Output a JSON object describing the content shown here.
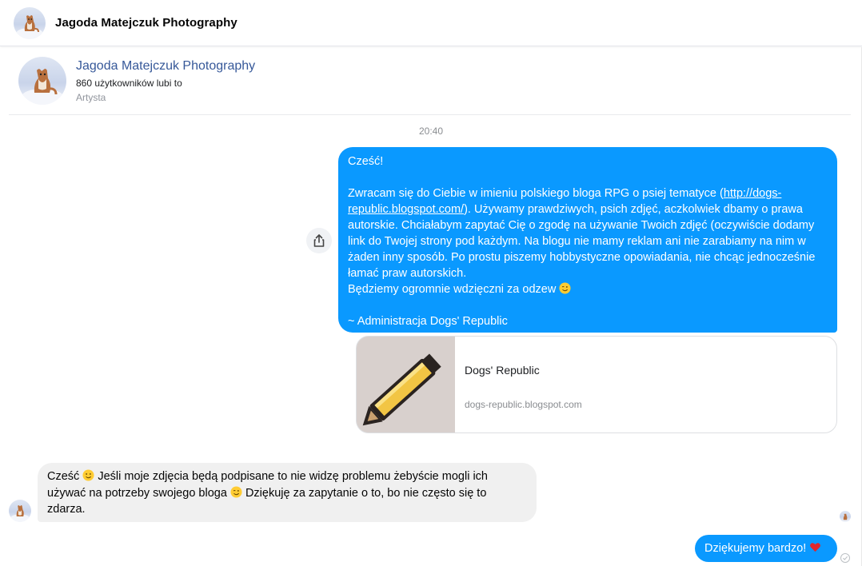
{
  "header": {
    "title": "Jagoda Matejczuk Photography",
    "avatar_icon": "dog-avatar"
  },
  "profile": {
    "name": "Jagoda Matejczuk Photography",
    "likes": "860 użytkowników lubi to",
    "category": "Artysta"
  },
  "thread": {
    "timestamp": "20:40",
    "share_icon": "share-icon"
  },
  "messages": {
    "outgoing": {
      "lines": [
        "Cześć!",
        "",
        "Zwracam się do Ciebie w imieniu polskiego bloga RPG o psiej tematyce (",
        "http://dogs-republic.blogspot.com/",
        "). Używamy prawdziwych, psich zdjęć, aczkolwiek dbamy o prawa autorskie. Chciałabym zapytać Cię o zgodę na używanie Twoich zdjęć (oczywiście dodamy link do Twojej strony pod każdym. Na blogu nie mamy reklam ani nie zarabiamy na nim w żaden inny sposób. Po prostu piszemy hobbystyczne opowiadania, nie chcąc jednocześnie łamać praw autorskich.",
        "Będziemy ogromnie wdzięczni za odzew ",
        "",
        "~ Administracja Dogs' Republic"
      ]
    },
    "link_preview": {
      "title": "Dogs' Republic",
      "domain": "dogs-republic.blogspot.com",
      "thumb_icon": "pencil-icon"
    },
    "incoming": {
      "part1": "Cześć ",
      "part2": " Jeśli moje zdjęcia będą podpisane to nie widzę problemu żebyście mogli ich używać na potrzeby swojego bloga ",
      "part3": " Dziękuję za zapytanie o to, bo nie często się to zdarza."
    },
    "reply": {
      "text": "Dziękujemy bardzo! ",
      "emoji": "heart-icon"
    }
  },
  "colors": {
    "outgoing_bubble": "#0a99ff",
    "incoming_bubble": "#f0f0f0",
    "profile_name": "#365899"
  }
}
